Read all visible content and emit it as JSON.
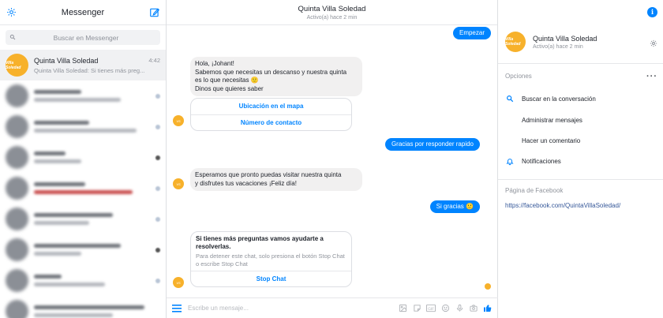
{
  "sidebar": {
    "title": "Messenger",
    "search_placeholder": "Buscar en Messenger",
    "active_conversation": {
      "name": "Quinta Villa Soledad",
      "time": "4:42",
      "snippet": "Quinta Villa Soledad: Si tienes más preg..."
    },
    "avatar_logo_text": "Villa Soledad"
  },
  "conversation": {
    "name": "Quinta Villa Soledad",
    "status": "Activo(a) hace 2 min",
    "messages": {
      "start": "Empezar",
      "greeting_lines": [
        "Hola, ¡Johant!",
        "Sabemos que necesitas un descanso y nuestra quinta",
        "es lo que necesitas",
        "Dinos que quieres saber"
      ],
      "emoji_smile": "🙂",
      "card1_buttons": [
        "Ubicación en el mapa",
        "Número de contacto"
      ],
      "thanks": "Gracias por responder rapido",
      "hope_lines": [
        "Esperamos que pronto puedas visitar nuestra quinta",
        "y disfrutes tus vacaciones ¡Feliz día!"
      ],
      "yes_thanks": "Si gracias",
      "card2_title": "Si tienes más preguntas vamos ayudarte a resolverlas.",
      "card2_subtitle": "Para detener este chat, solo presiona el botón Stop Chat o escribe Stop Chat",
      "card2_button": "Stop Chat"
    },
    "composer_placeholder": "Escribe un mensaje..."
  },
  "details": {
    "name": "Quinta Villa Soledad",
    "status": "Activo(a) hace 2 min",
    "options_label": "Opciones",
    "options": [
      {
        "label": "Buscar en la conversación",
        "icon": "search-icon"
      },
      {
        "label": "Administrar mensajes",
        "icon": ""
      },
      {
        "label": "Hacer un comentario",
        "icon": ""
      },
      {
        "label": "Notificaciones",
        "icon": "bell-icon"
      }
    ],
    "facebook_label": "Página de Facebook",
    "facebook_url": "https://facebook.com/QuintaVillaSoledad/"
  },
  "colors": {
    "accent": "#0084ff",
    "brand_logo": "#f7b12b"
  }
}
